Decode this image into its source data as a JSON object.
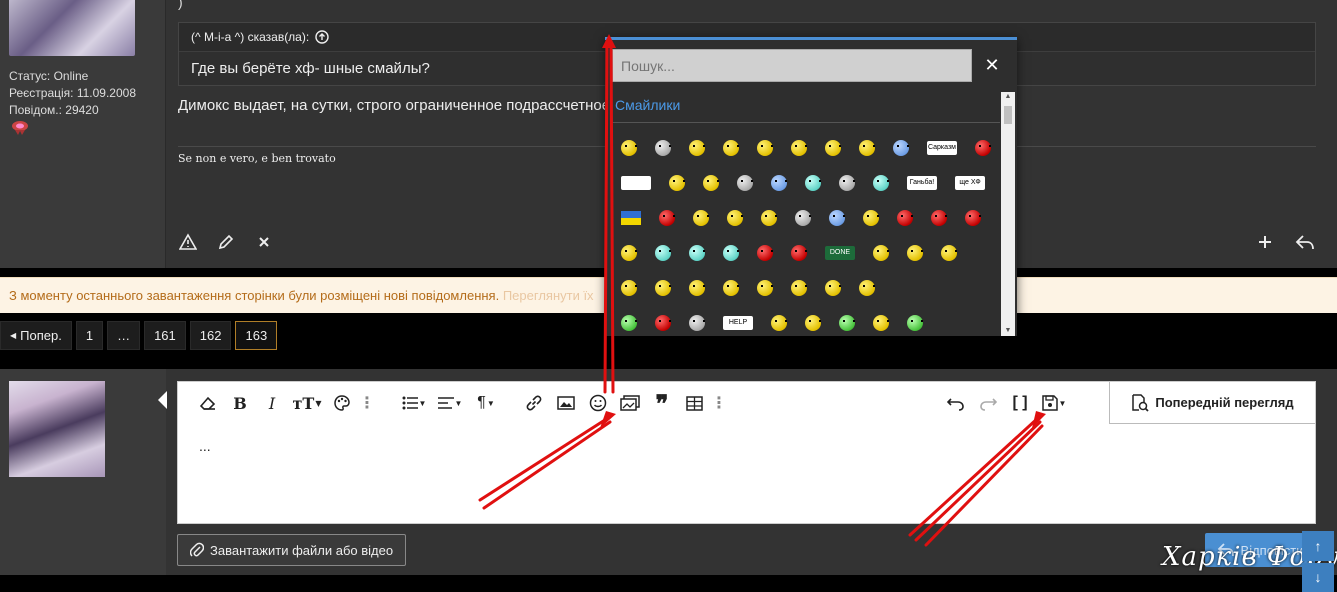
{
  "post1": {
    "paren": ")",
    "status": "Статус: Online",
    "registration": "Реєстрація: 11.09.2008",
    "messages": "Повідом.: 29420",
    "quote_author": "(^ M-i-a ^) сказав(ла):",
    "quote_text": "Где вы берёте хф- шные смайлы?",
    "body_text": "Димокс выдает, на сутки, строго ограниченное подрассчетное",
    "signature": "Se non e vero, e ben trovato"
  },
  "notice": {
    "text": "З моменту останнього завантаження сторінки були розміщені нові повідомлення.",
    "link": "Переглянути їх"
  },
  "pagination": {
    "prev": "Попер.",
    "pages": [
      "1",
      "…",
      "161",
      "162",
      "163"
    ],
    "current": "163"
  },
  "editor": {
    "text": "...",
    "preview_label": "Попередній перегляд",
    "upload_label": "Завантажити файли або відео",
    "reply_label": "Відповісти"
  },
  "smiley_popup": {
    "search_placeholder": "Пошук...",
    "category": "Смайлики",
    "sign_labels": {
      "sarcasm": "Сарказм",
      "shame": "Ганьба!",
      "hf": "ще ХФ",
      "done": "DONE",
      "help": "HELP"
    }
  },
  "watermark": "Харків Форум",
  "colors": {
    "accent": "#4b8fd4",
    "notice_bg": "#fdf3e4",
    "notice_text": "#b46c1a",
    "arrow": "#e01010"
  }
}
